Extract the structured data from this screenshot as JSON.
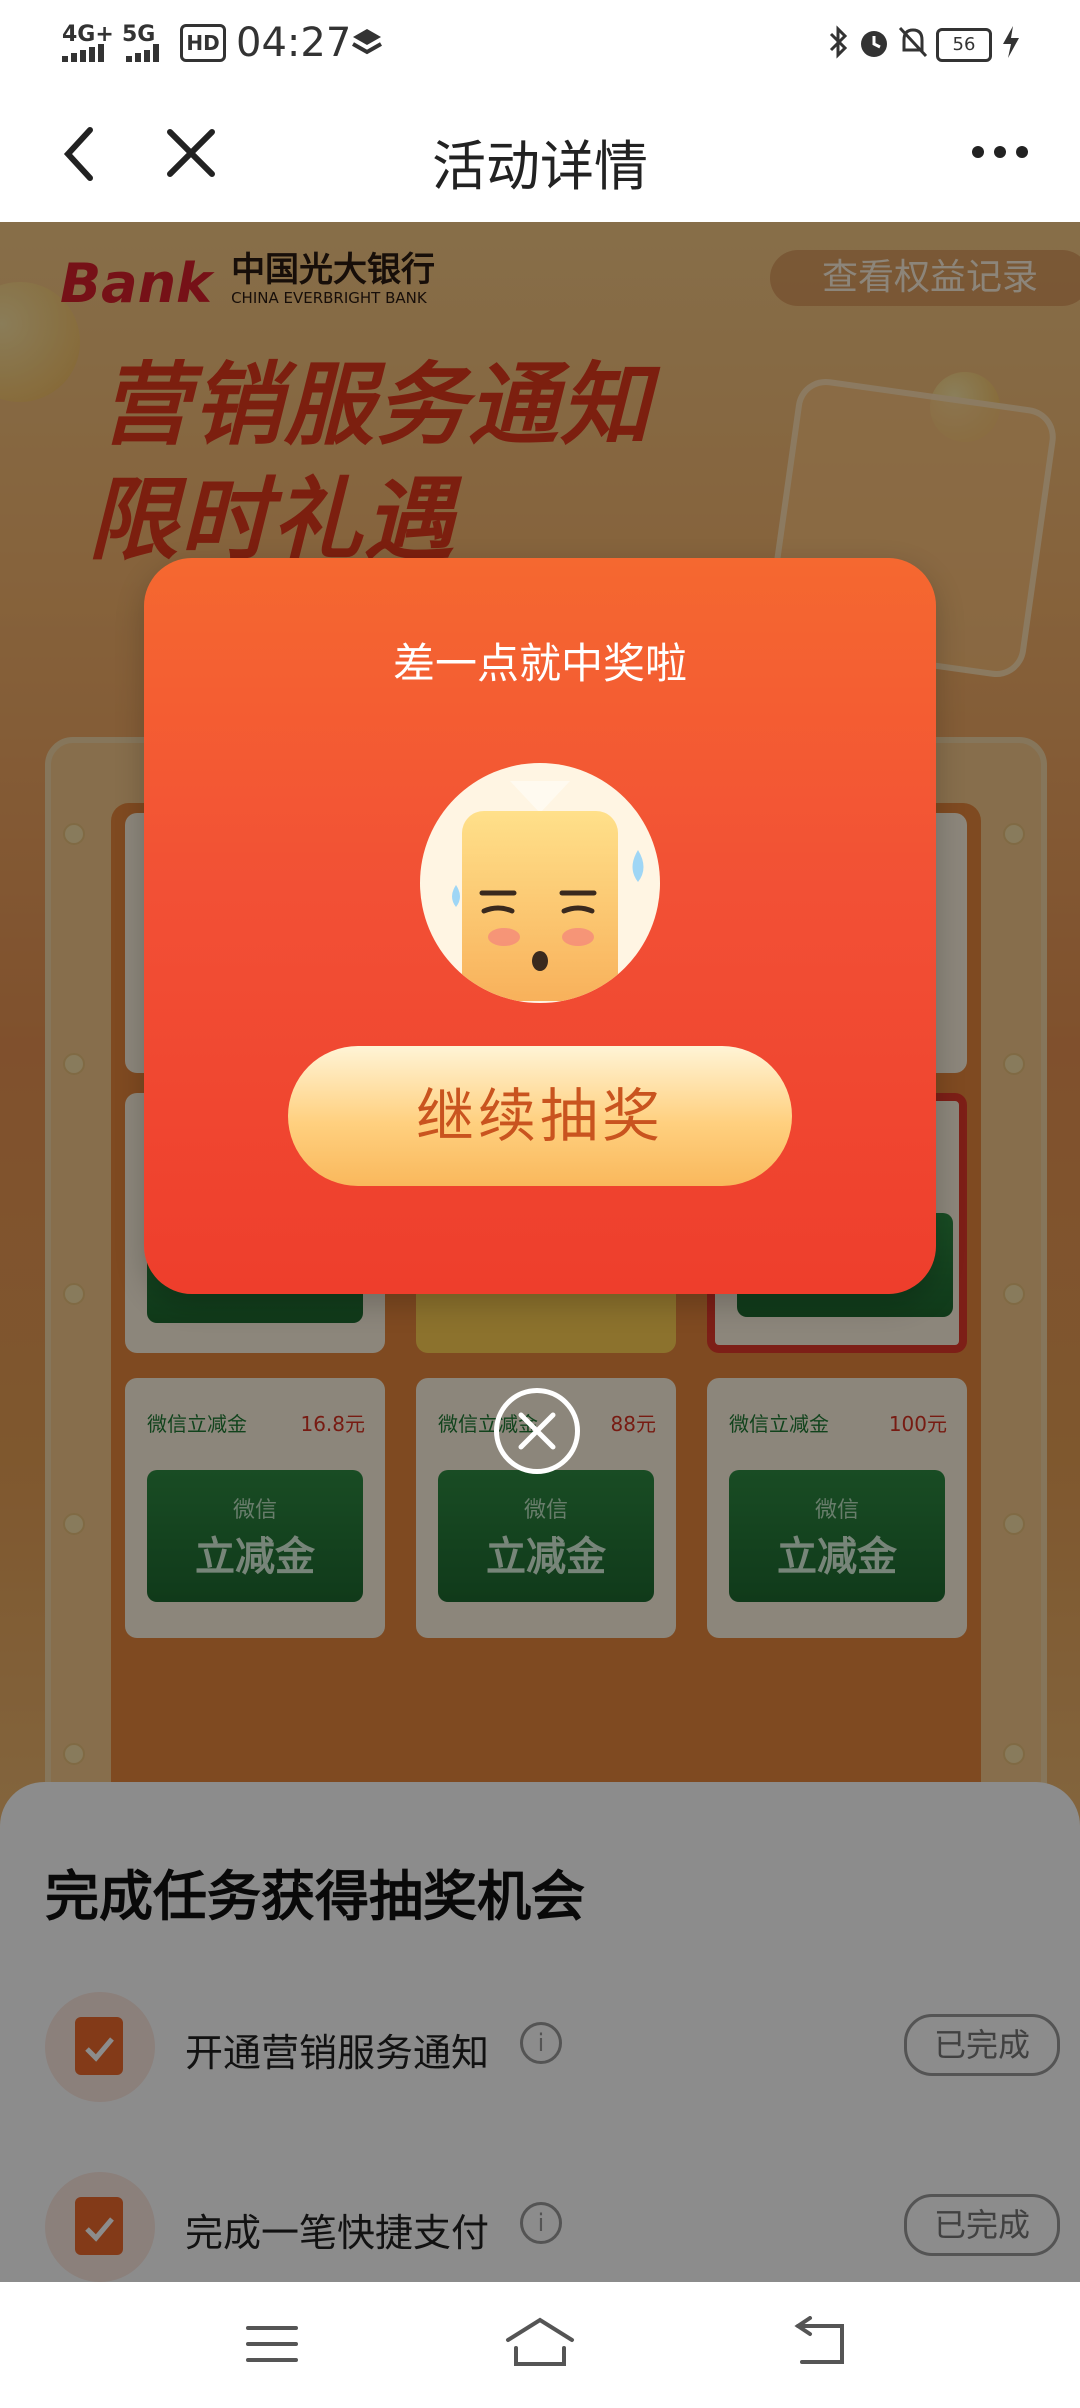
{
  "status_bar": {
    "network1": "4G+",
    "network2": "5G",
    "hd": "HD",
    "time": "04:27",
    "battery": "56"
  },
  "nav": {
    "title": "活动详情"
  },
  "banner": {
    "brand_cn": "中国光大银行",
    "brand_en": "CHINA EVERBRIGHT BANK",
    "brand_logo": "Bank",
    "record_button": "查看权益记录",
    "headline1": "营销服务通知",
    "headline2": "限时礼遇"
  },
  "grid": {
    "cells": [
      {
        "name": "微信立减金",
        "value": "16.8元",
        "card_line1": "微信",
        "card_line2": "立减金"
      },
      {
        "name": "微信立减金",
        "value": "88元",
        "card_line1": "微信",
        "card_line2": "立减金"
      },
      {
        "name": "微信立减金",
        "value": "100元",
        "card_line1": "微信",
        "card_line2": "立减金"
      }
    ]
  },
  "tasks": {
    "title": "完成任务获得抽奖机会",
    "items": [
      {
        "label": "开通营销服务通知",
        "status": "已完成",
        "info": "i"
      },
      {
        "label": "完成一笔快捷支付",
        "status": "已完成",
        "info": "i"
      }
    ]
  },
  "modal": {
    "title": "差一点就中奖啦",
    "button": "继续抽奖"
  },
  "colors": {
    "modal_top": "#f56830",
    "modal_bottom": "#ee3e2c",
    "button_text": "#c9541f",
    "brand_red": "#e23a1d"
  }
}
